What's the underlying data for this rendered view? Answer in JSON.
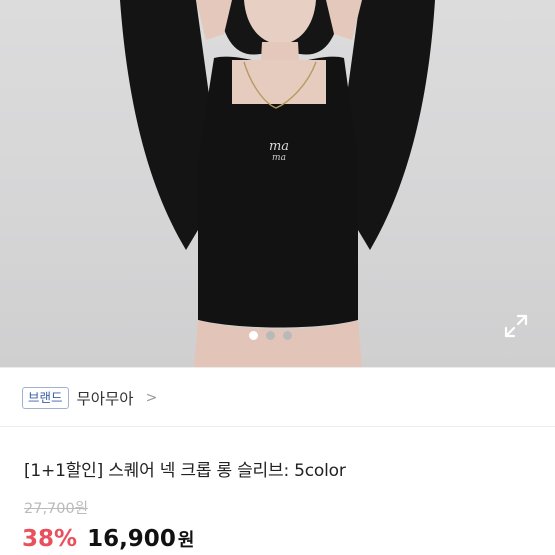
{
  "product": {
    "brand_badge": "브랜드",
    "brand_name": "무아무아",
    "brand_chevron": ">",
    "title": "[1+1할인] 스퀘어 넥 크롭 롱 슬리브: 5color",
    "original_price": "27,700원",
    "discount": "38%",
    "price": "16,900",
    "price_unit": "원"
  },
  "gallery": {
    "slide_count": 3,
    "active_index": 0,
    "expand_icon": "expand-icon"
  },
  "colors": {
    "discount": "#e8505b",
    "brand_badge_border": "#9fb2d6",
    "brand_badge_text": "#3a5ea8"
  }
}
